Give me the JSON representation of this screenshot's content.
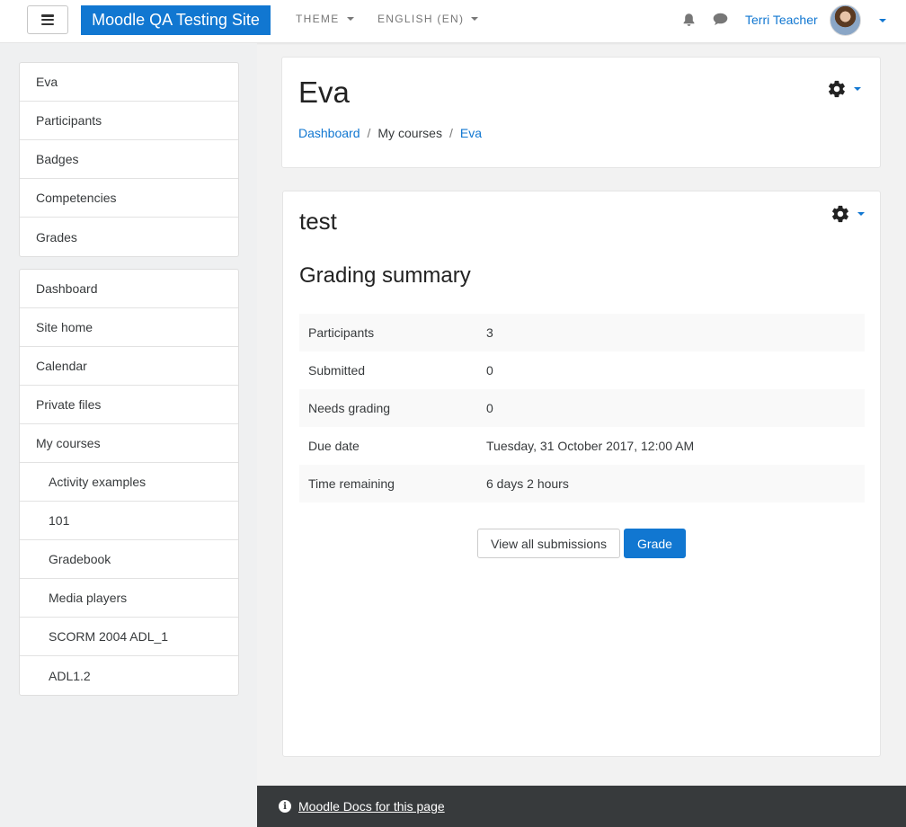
{
  "navbar": {
    "site_name": "Moodle QA Testing Site",
    "theme_label": "THEME",
    "language_label": "ENGLISH (EN)",
    "user_name": "Terri Teacher",
    "icons": [
      "hamburger-icon",
      "bell-icon",
      "chat-icon",
      "avatar",
      "chevron-down-icon"
    ]
  },
  "sidebar": {
    "course_nav": [
      {
        "label": "Eva"
      },
      {
        "label": "Participants"
      },
      {
        "label": "Badges"
      },
      {
        "label": "Competencies"
      },
      {
        "label": "Grades"
      }
    ],
    "site_nav": [
      {
        "label": "Dashboard"
      },
      {
        "label": "Site home"
      },
      {
        "label": "Calendar"
      },
      {
        "label": "Private files"
      },
      {
        "label": "My courses"
      },
      {
        "label": "Activity examples"
      },
      {
        "label": "101"
      },
      {
        "label": "Gradebook"
      },
      {
        "label": "Media players"
      },
      {
        "label": "SCORM 2004 ADL_1"
      },
      {
        "label": "ADL1.2"
      }
    ]
  },
  "header": {
    "title": "Eva",
    "breadcrumb": [
      {
        "label": "Dashboard",
        "link": true
      },
      {
        "label": "My courses",
        "link": false
      },
      {
        "label": "Eva",
        "link": true
      }
    ],
    "separator": "/"
  },
  "main": {
    "activity_title": "test",
    "section_title": "Grading summary",
    "summary_rows": [
      {
        "label": "Participants",
        "value": "3"
      },
      {
        "label": "Submitted",
        "value": "0"
      },
      {
        "label": "Needs grading",
        "value": "0"
      },
      {
        "label": "Due date",
        "value": "Tuesday, 31 October 2017, 12:00 AM"
      },
      {
        "label": "Time remaining",
        "value": "6 days 2 hours"
      }
    ],
    "view_all_label": "View all submissions",
    "grade_label": "Grade"
  },
  "footer": {
    "docs_link": "Moodle Docs for this page"
  },
  "colors": {
    "brand": "#1177d1",
    "link": "#1177d1",
    "footer_bg": "#373a3c",
    "drawer_bg": "#eff0f1"
  }
}
